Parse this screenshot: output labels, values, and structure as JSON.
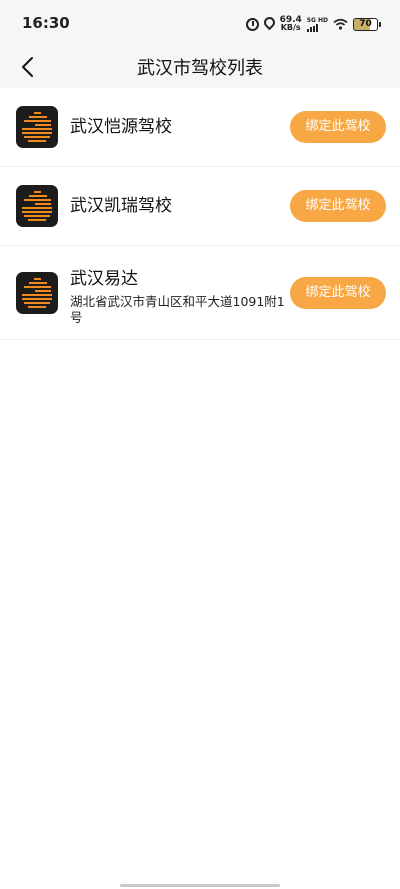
{
  "status": {
    "time": "16:30",
    "speed_value": "69.4",
    "speed_unit": "KB/s",
    "network_label": "5G HD",
    "battery": "70"
  },
  "header": {
    "title": "武汉市驾校列表"
  },
  "schools": [
    {
      "name": "武汉恺源驾校",
      "address": "",
      "button_label": "绑定此驾校"
    },
    {
      "name": "武汉凯瑞驾校",
      "address": "",
      "button_label": "绑定此驾校"
    },
    {
      "name": "武汉易达",
      "address": "湖北省武汉市青山区和平大道1091附1号",
      "button_label": "绑定此驾校"
    }
  ],
  "colors": {
    "accent": "#f7a744",
    "logo_bg": "#1c1c1c",
    "logo_stripe": "#f08a1c"
  },
  "icons": {
    "back": "chevron-left-icon",
    "logo": "school-logo-icon"
  }
}
